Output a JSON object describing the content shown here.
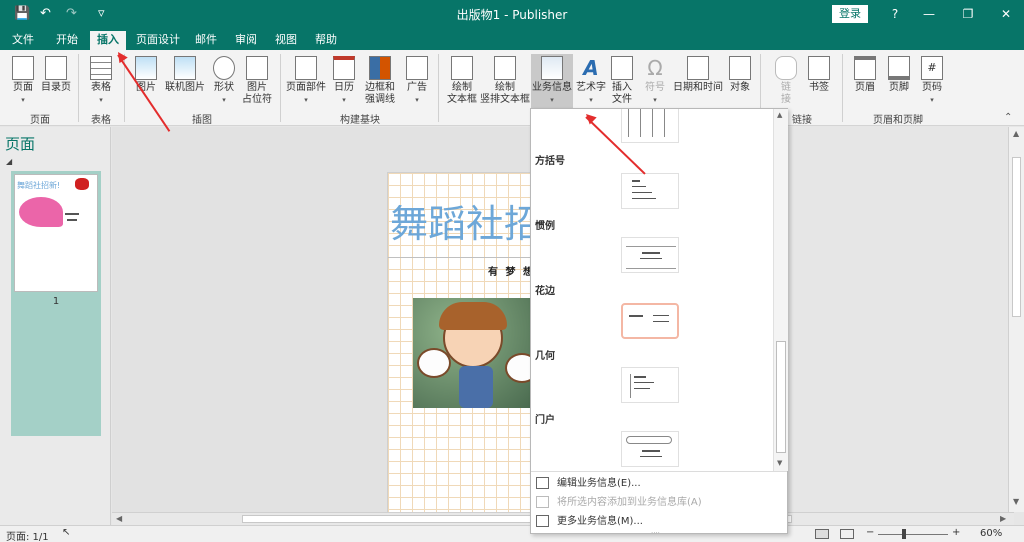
{
  "app": {
    "title": "出版物1  -  Publisher",
    "login": "登录",
    "help": "?",
    "qa_save": "💾",
    "qa_undo": "↶",
    "qa_redo": "↷",
    "qa_more": "▿"
  },
  "tabs": [
    "文件",
    "开始",
    "插入",
    "页面设计",
    "邮件",
    "审阅",
    "视图",
    "帮助"
  ],
  "ribbon": {
    "pages_group": {
      "page": "页面",
      "catalog": "目录页",
      "label": "页面"
    },
    "tables_group": {
      "table": "表格",
      "label": "表格"
    },
    "illus_group": {
      "picture": "图片",
      "online_picture": "联机图片",
      "shapes": "形状",
      "picture_placeholder_1": "图片",
      "picture_placeholder_2": "占位符",
      "label": "插图"
    },
    "building_group": {
      "page_parts": "页面部件",
      "calendar": "日历",
      "borders_1": "边框和",
      "borders_2": "强调线",
      "ads": "广告",
      "label": "构建基块"
    },
    "text_group": {
      "draw_textbox_1": "绘制",
      "draw_textbox_2": "文本框",
      "draw_vtextbox_1": "绘制",
      "draw_vtextbox_2": "竖排文本框",
      "business_info": "业务信息",
      "wordart": "艺术字",
      "insert_file_1": "插入",
      "insert_file_2": "文件",
      "symbol": "符号",
      "datetime": "日期和时间",
      "object": "对象"
    },
    "links_group": {
      "link_1": "链",
      "link_2": "接",
      "bookmark": "书签",
      "label": "链接"
    },
    "header_group": {
      "header": "页眉",
      "footer": "页脚",
      "pagenum": "页码",
      "label": "页眉和页脚"
    }
  },
  "pages_panel": {
    "title": "页面",
    "page_number": "1",
    "thumb_title": "舞蹈社招新!"
  },
  "document": {
    "title": "舞蹈社招",
    "subtitle": "有 梦 想 就"
  },
  "dropdown": {
    "categories": [
      "方括号",
      "惯例",
      "花边",
      "几何",
      "门户"
    ],
    "menu": [
      {
        "label": "编辑业务信息(E)...",
        "disabled": false
      },
      {
        "label": "将所选内容添加到业务信息库(A)",
        "disabled": true
      },
      {
        "label": "更多业务信息(M)...",
        "disabled": false
      }
    ]
  },
  "status": {
    "page": "页面: 1/1",
    "zoom": "60%",
    "minus": "−",
    "plus": "+"
  }
}
